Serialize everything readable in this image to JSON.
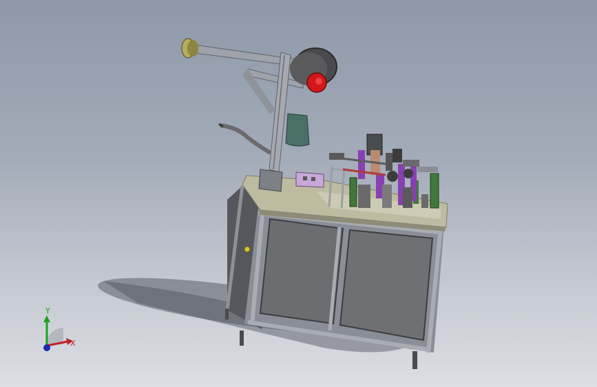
{
  "viewport": {
    "background_top": "#8e98a8",
    "background_bottom": "#dcdee3"
  },
  "axis_triad": {
    "x_label": "X",
    "y_label": "Y",
    "x_color": "#c0202a",
    "y_color": "#1aa31a",
    "z_color": "#1a2ab0"
  },
  "model": {
    "frame_color": "#7c8088",
    "panel_color": "#6e6f73",
    "top_plate_color": "#bdbba0",
    "reel_color": "#4a4a4c",
    "motor_color": "#d01818",
    "tank_color": "#4a6f66",
    "accent_purple": "#8a3fb0",
    "accent_green": "#3f7a3a",
    "handle_color": "#d4c43a"
  }
}
